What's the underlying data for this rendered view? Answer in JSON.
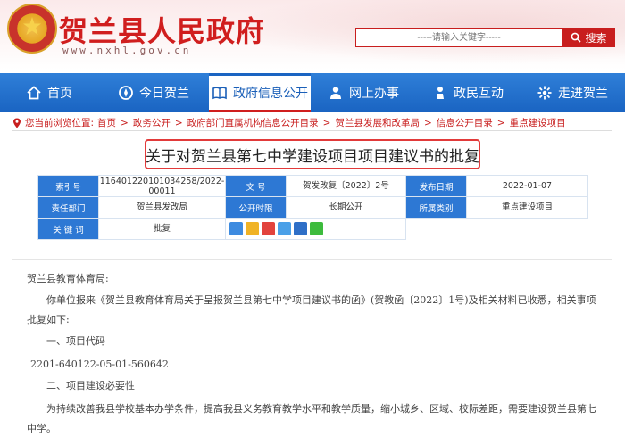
{
  "header": {
    "site_title": "贺兰县人民政府",
    "site_url": "www.nxhl.gov.cn",
    "search_placeholder": "-----请输入关键字-----",
    "search_button": "搜索"
  },
  "nav": [
    {
      "label": "首页",
      "icon": "home-icon"
    },
    {
      "label": "今日贺兰",
      "icon": "compass-icon"
    },
    {
      "label": "政府信息公开",
      "icon": "book-icon",
      "active": true
    },
    {
      "label": "网上办事",
      "icon": "person-icon"
    },
    {
      "label": "政民互动",
      "icon": "people-icon"
    },
    {
      "label": "走进贺兰",
      "icon": "flower-icon"
    }
  ],
  "breadcrumb": {
    "prefix": "您当前浏览位置:",
    "items": [
      "首页",
      "政务公开",
      "政府部门直属机构信息公开目录",
      "贺兰县发展和改革局",
      "信息公开目录",
      "重点建设项目"
    ]
  },
  "article": {
    "title": "关于对贺兰县第七中学建设项目项目建议书的批复",
    "meta": {
      "index_label": "索引号",
      "index_value": "116401220101034258/2022-00011",
      "doc_no_label": "文 号",
      "doc_no_value": "贺发改复〔2022〕2号",
      "date_label": "发布日期",
      "date_value": "2022-01-07",
      "dept_label": "责任部门",
      "dept_value": "贺兰县发改局",
      "period_label": "公开时限",
      "period_value": "长期公开",
      "category_label": "所属类别",
      "category_value": "重点建设项目",
      "keywords_label": "关 键 词",
      "keywords_value": "批复"
    },
    "paragraphs": [
      "贺兰县教育体育局:",
      "你单位报来《贺兰县教育体育局关于呈报贺兰县第七中学项目建议书的函》(贺教函〔2022〕1号)及相关材料已收悉，相关事项批复如下:",
      "一、项目代码",
      "2201-640122-05-01-560642",
      "二、项目建设必要性",
      "为持续改善我县学校基本办学条件，提高我县义务教育教学水平和教学质量，缩小城乡、区域、校际差距，需要建设贺兰县第七中学。"
    ]
  },
  "colors": {
    "brand_red": "#d01e1e",
    "nav_blue": "#1a64c2",
    "label_blue": "#2d78d4"
  }
}
